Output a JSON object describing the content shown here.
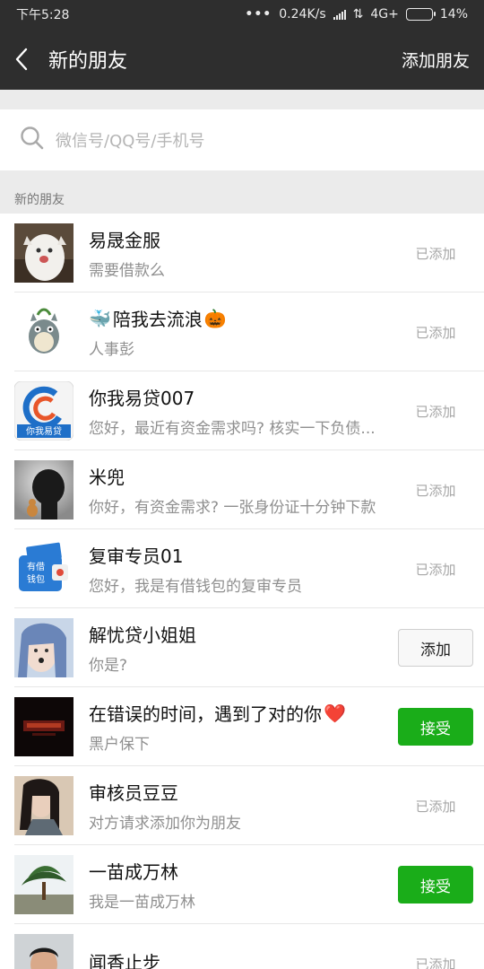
{
  "status_bar": {
    "time": "下午5:28",
    "dots": "•••",
    "speed": "0.24K/s",
    "network": "4G+",
    "battery": "14%",
    "battery_level": 0.14
  },
  "nav": {
    "title": "新的朋友",
    "action": "添加朋友",
    "bg": "#2e2e2e"
  },
  "search": {
    "placeholder": "微信号/QQ号/手机号"
  },
  "section": {
    "title": "新的朋友"
  },
  "colors": {
    "accept_green": "#1aad19",
    "muted": "#a6a6a6"
  },
  "friends": [
    {
      "name": "易晟金服",
      "message": "需要借款么",
      "status": "已添加"
    },
    {
      "name": "陪我去流浪",
      "name_prefix_icon": "whale-emoji",
      "name_suffix_icon": "jack-o-lantern-emoji",
      "message": "人事彭",
      "status": "已添加"
    },
    {
      "name": "你我易贷007",
      "message": "您好，最近有资金需求吗? 核实一下负债...",
      "status": "已添加",
      "avatar_text": "你我易贷"
    },
    {
      "name": "米兜",
      "message": "你好，有资金需求? 一张身份证十分钟下款",
      "status": "已添加"
    },
    {
      "name": "复审专员01",
      "message": "您好，我是有借钱包的复审专员",
      "status": "已添加",
      "avatar_text": "有借钱包"
    },
    {
      "name": "解忧贷小姐姐",
      "message": "你是?",
      "button": "添加"
    },
    {
      "name": "在错误的时间，遇到了对的你",
      "name_suffix_icon": "red-heart-emoji",
      "message": "黑户保下",
      "button_accept": "接受"
    },
    {
      "name": "审核员豆豆",
      "message": "对方请求添加你为朋友",
      "status": "已添加"
    },
    {
      "name": "一苗成万林",
      "message": "我是一苗成万林",
      "button_accept": "接受"
    },
    {
      "name": "闻香止步",
      "message": "",
      "status": "已添加"
    }
  ]
}
